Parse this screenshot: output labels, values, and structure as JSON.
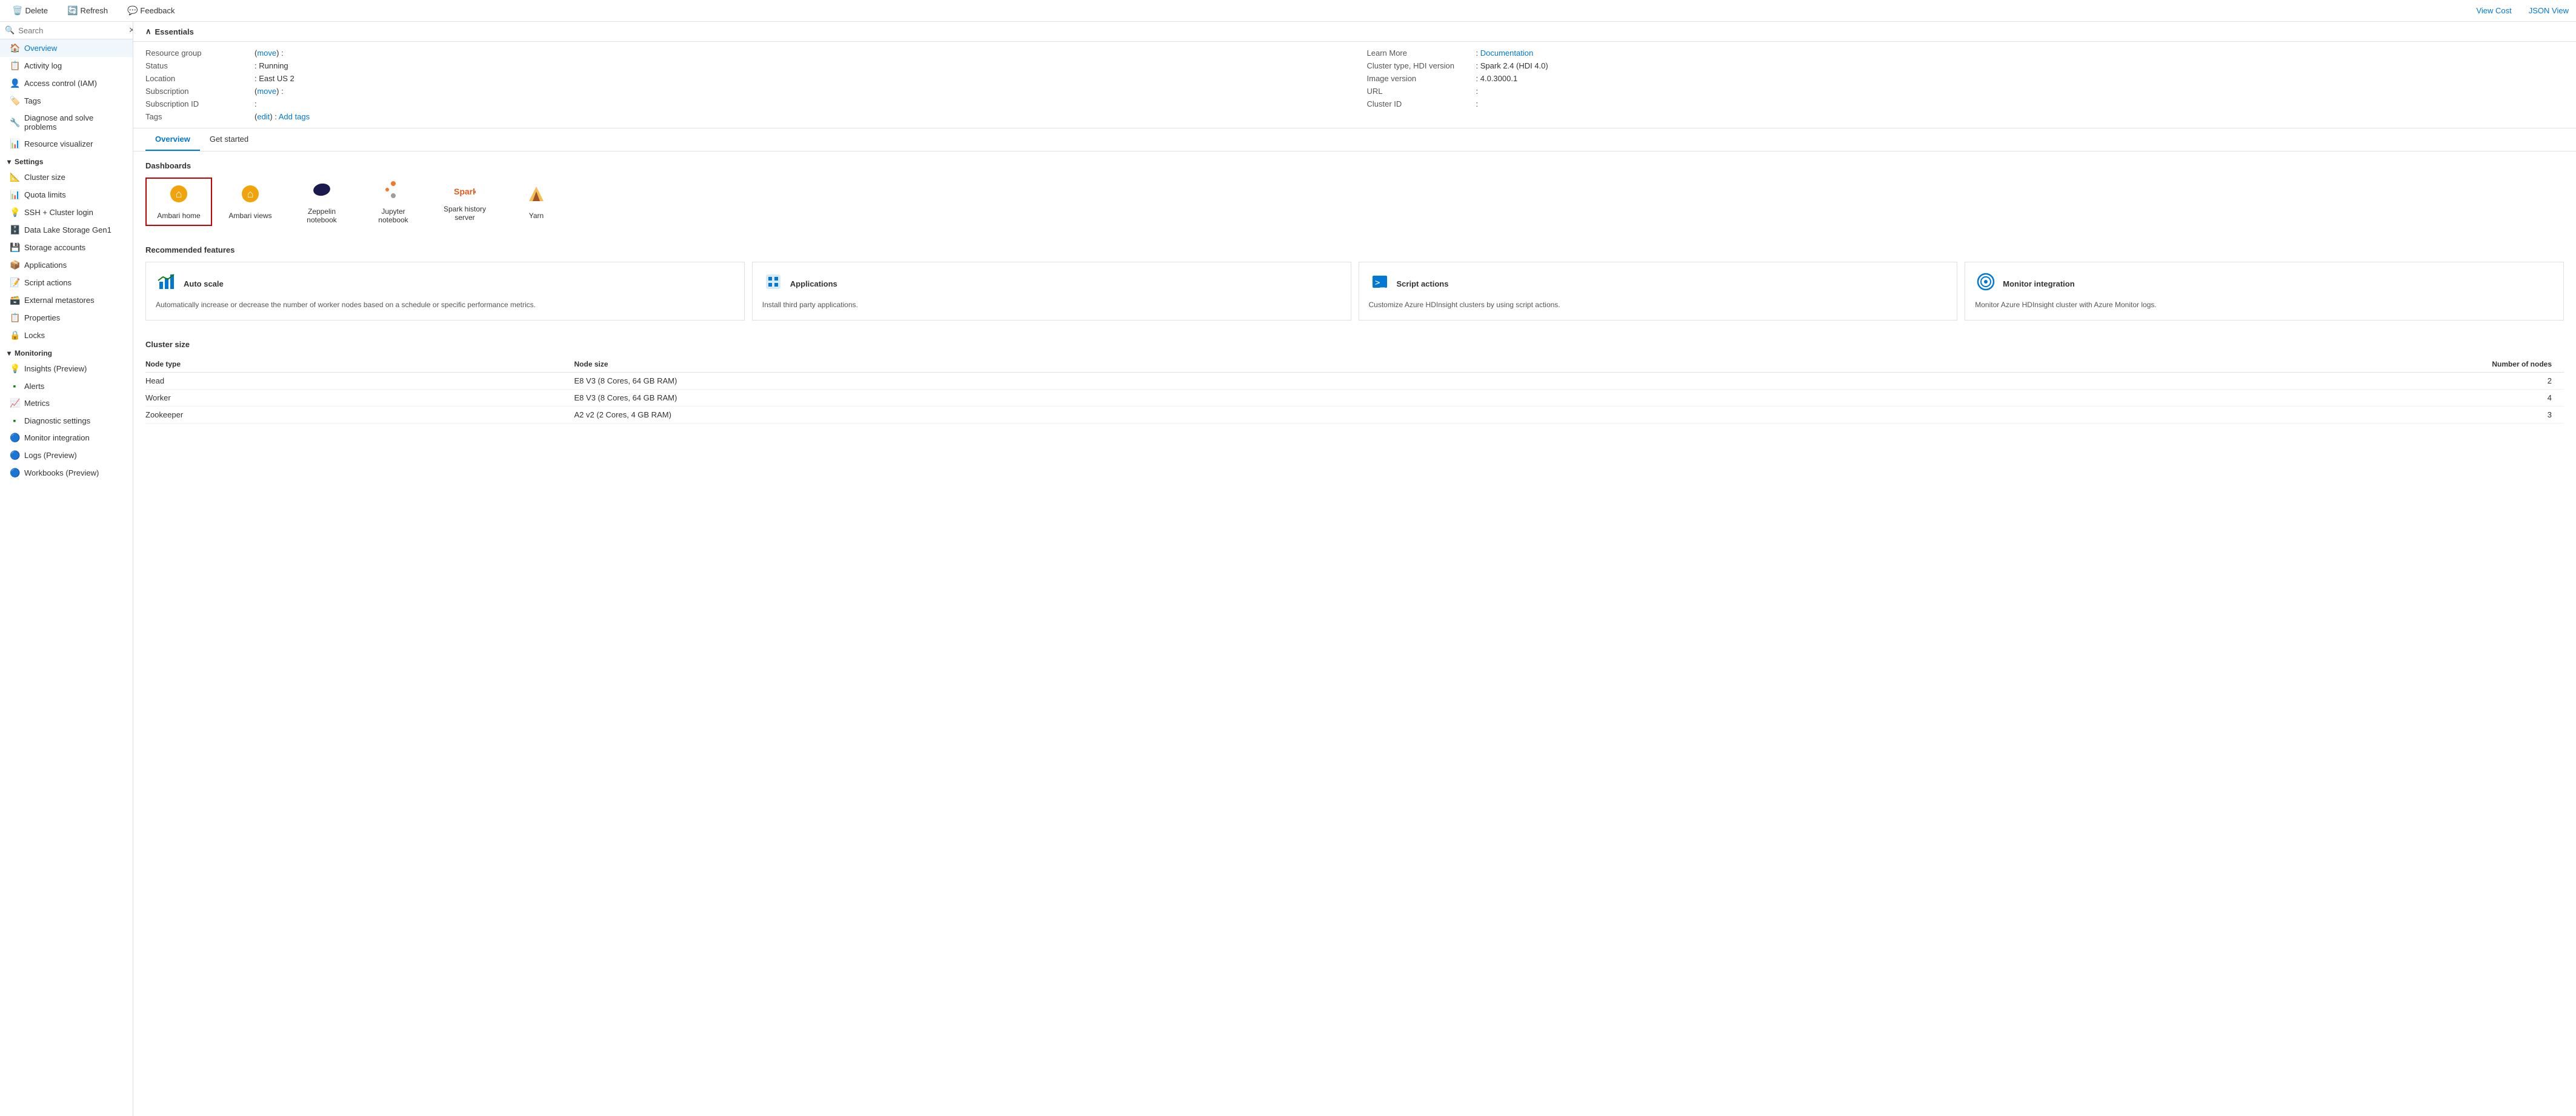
{
  "toolbar": {
    "delete_label": "Delete",
    "refresh_label": "Refresh",
    "feedback_label": "Feedback",
    "view_cost_label": "View Cost",
    "json_view_label": "JSON View"
  },
  "sidebar": {
    "search_placeholder": "Search",
    "items": [
      {
        "id": "overview",
        "label": "Overview",
        "icon": "🏠",
        "active": true
      },
      {
        "id": "activity-log",
        "label": "Activity log",
        "icon": "📋",
        "active": false
      },
      {
        "id": "access-control",
        "label": "Access control (IAM)",
        "icon": "👤",
        "active": false
      },
      {
        "id": "tags",
        "label": "Tags",
        "icon": "🏷️",
        "active": false
      },
      {
        "id": "diagnose",
        "label": "Diagnose and solve problems",
        "icon": "🔧",
        "active": false
      },
      {
        "id": "resource-visualizer",
        "label": "Resource visualizer",
        "icon": "📊",
        "active": false
      }
    ],
    "settings_header": "Settings",
    "settings_items": [
      {
        "id": "cluster-size",
        "label": "Cluster size",
        "icon": "📐"
      },
      {
        "id": "quota-limits",
        "label": "Quota limits",
        "icon": "📊"
      },
      {
        "id": "ssh-cluster",
        "label": "SSH + Cluster login",
        "icon": "💡"
      },
      {
        "id": "data-lake",
        "label": "Data Lake Storage Gen1",
        "icon": "🗄️"
      },
      {
        "id": "storage-accounts",
        "label": "Storage accounts",
        "icon": "💾"
      },
      {
        "id": "applications",
        "label": "Applications",
        "icon": "📦"
      },
      {
        "id": "script-actions",
        "label": "Script actions",
        "icon": "📝"
      },
      {
        "id": "external-metastores",
        "label": "External metastores",
        "icon": "🗃️"
      },
      {
        "id": "properties",
        "label": "Properties",
        "icon": "📋"
      },
      {
        "id": "locks",
        "label": "Locks",
        "icon": "🔒"
      }
    ],
    "monitoring_header": "Monitoring",
    "monitoring_items": [
      {
        "id": "insights",
        "label": "Insights (Preview)",
        "icon": "💡"
      },
      {
        "id": "alerts",
        "label": "Alerts",
        "icon": "🟩"
      },
      {
        "id": "metrics",
        "label": "Metrics",
        "icon": "📈"
      },
      {
        "id": "diagnostic-settings",
        "label": "Diagnostic settings",
        "icon": "🟩"
      },
      {
        "id": "monitor-integration",
        "label": "Monitor integration",
        "icon": "🔵"
      },
      {
        "id": "logs-preview",
        "label": "Logs (Preview)",
        "icon": "🔵"
      },
      {
        "id": "workbooks-preview",
        "label": "Workbooks (Preview)",
        "icon": "🔵"
      }
    ]
  },
  "essentials": {
    "section_title": "Essentials",
    "resource_group_label": "Resource group",
    "resource_group_link": "move",
    "status_label": "Status",
    "status_value": "Running",
    "location_label": "Location",
    "location_value": "East US 2",
    "subscription_label": "Subscription",
    "subscription_link": "move",
    "subscription_id_label": "Subscription ID",
    "tags_label": "Tags",
    "tags_edit_link": "edit",
    "tags_add_link": "Add tags",
    "learn_more_label": "Learn More",
    "documentation_link": "Documentation",
    "cluster_type_label": "Cluster type, HDI version",
    "cluster_type_value": "Spark 2.4 (HDI 4.0)",
    "image_version_label": "Image version",
    "image_version_value": "4.0.3000.1",
    "url_label": "URL",
    "cluster_id_label": "Cluster ID"
  },
  "tabs": [
    {
      "id": "overview",
      "label": "Overview",
      "active": true
    },
    {
      "id": "get-started",
      "label": "Get started",
      "active": false
    }
  ],
  "dashboards": {
    "section_title": "Dashboards",
    "items": [
      {
        "id": "ambari-home",
        "label": "Ambari home",
        "icon": "🟡",
        "highlighted": true
      },
      {
        "id": "ambari-views",
        "label": "Ambari views",
        "icon": "🟡",
        "highlighted": false
      },
      {
        "id": "zeppelin-notebook",
        "label": "Zeppelin notebook",
        "icon": "🔵",
        "highlighted": false
      },
      {
        "id": "jupyter-notebook",
        "label": "Jupyter notebook",
        "icon": "🔶",
        "highlighted": false
      },
      {
        "id": "spark-history",
        "label": "Spark history server",
        "icon": "✨",
        "highlighted": false
      },
      {
        "id": "yarn",
        "label": "Yarn",
        "icon": "🐘",
        "highlighted": false
      }
    ]
  },
  "recommended": {
    "section_title": "Recommended features",
    "features": [
      {
        "id": "auto-scale",
        "icon": "📊",
        "title": "Auto scale",
        "description": "Automatically increase or decrease the number of worker nodes based on a schedule or specific performance metrics."
      },
      {
        "id": "applications",
        "icon": "📦",
        "title": "Applications",
        "description": "Install third party applications."
      },
      {
        "id": "script-actions",
        "icon": "💻",
        "title": "Script actions",
        "description": "Customize Azure HDInsight clusters by using script actions."
      },
      {
        "id": "monitor-integration",
        "icon": "🔵",
        "title": "Monitor integration",
        "description": "Monitor Azure HDInsight cluster with Azure Monitor logs."
      }
    ]
  },
  "cluster_size": {
    "section_title": "Cluster size",
    "headers": [
      "Node type",
      "Node size",
      "Number of nodes"
    ],
    "rows": [
      {
        "node_type": "Head",
        "node_size": "E8 V3 (8 Cores, 64 GB RAM)",
        "num_nodes": "2"
      },
      {
        "node_type": "Worker",
        "node_size": "E8 V3 (8 Cores, 64 GB RAM)",
        "num_nodes": "4"
      },
      {
        "node_type": "Zookeeper",
        "node_size": "A2 v2 (2 Cores, 4 GB RAM)",
        "num_nodes": "3"
      }
    ]
  }
}
